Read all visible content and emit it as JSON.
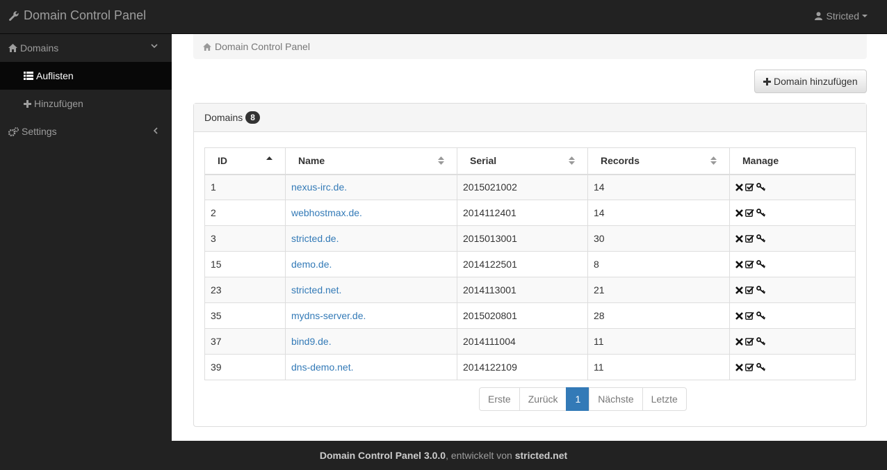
{
  "header": {
    "brand": "Domain Control Panel",
    "user": "Stricted"
  },
  "sidebar": {
    "items": [
      {
        "label": "Domains",
        "icon": "home-icon"
      },
      {
        "label": "Auflisten",
        "icon": "list-icon"
      },
      {
        "label": "Hinzufügen",
        "icon": "plus-icon"
      },
      {
        "label": "Settings",
        "icon": "gears-icon"
      }
    ]
  },
  "breadcrumb": {
    "label": "Domain Control Panel"
  },
  "add_button": {
    "label": "Domain hinzufügen"
  },
  "panel": {
    "title": "Domains",
    "count": "8"
  },
  "table": {
    "headers": [
      "ID",
      "Name",
      "Serial",
      "Records",
      "Manage"
    ],
    "rows": [
      {
        "id": "1",
        "name": "nexus-irc.de.",
        "serial": "2015021002",
        "records": "14"
      },
      {
        "id": "2",
        "name": "webhostmax.de.",
        "serial": "2014112401",
        "records": "14"
      },
      {
        "id": "3",
        "name": "stricted.de.",
        "serial": "2015013001",
        "records": "30"
      },
      {
        "id": "15",
        "name": "demo.de.",
        "serial": "2014122501",
        "records": "8"
      },
      {
        "id": "23",
        "name": "stricted.net.",
        "serial": "2014113001",
        "records": "21"
      },
      {
        "id": "35",
        "name": "mydns-server.de.",
        "serial": "2015020801",
        "records": "28"
      },
      {
        "id": "37",
        "name": "bind9.de.",
        "serial": "2014111004",
        "records": "11"
      },
      {
        "id": "39",
        "name": "dns-demo.net.",
        "serial": "2014122109",
        "records": "11"
      }
    ]
  },
  "pagination": {
    "first": "Erste",
    "prev": "Zurück",
    "current": "1",
    "next": "Nächste",
    "last": "Letzte"
  },
  "footer": {
    "product": "Domain Control Panel 3.0.0",
    "text": ", entwickelt von ",
    "author": "stricted.net"
  },
  "colors": {
    "navbar": "#222222",
    "link": "#337ab7",
    "active_page": "#337ab7"
  }
}
